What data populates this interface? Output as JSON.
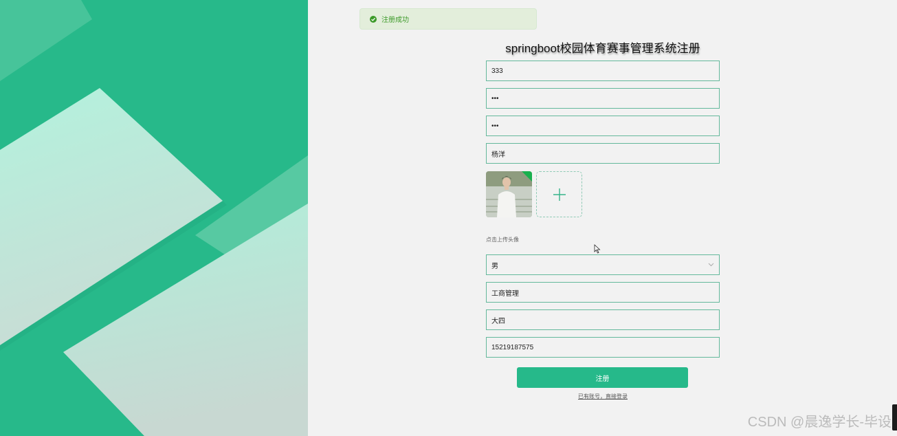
{
  "toast": {
    "message": "注册成功",
    "status_color": "#3d9a2a"
  },
  "form": {
    "title": "springboot校园体育赛事管理系统注册",
    "account_value": "333",
    "password_value": "•••",
    "confirm_password_value": "•••",
    "name_value": "杨洋",
    "avatar": {
      "upload_icon": "plus-icon",
      "hint": "点击上传头像"
    },
    "gender": {
      "selected": "男",
      "icon": "chevron-down-icon"
    },
    "major_value": "工商管理",
    "grade_value": "大四",
    "phone_value": "15219187575",
    "submit_label": "注册",
    "login_link": "已有账号，直接登录"
  },
  "watermark": "CSDN @晨逸学长-毕设",
  "colors": {
    "brand": "#26b98a",
    "input_border": "#63b89b"
  }
}
